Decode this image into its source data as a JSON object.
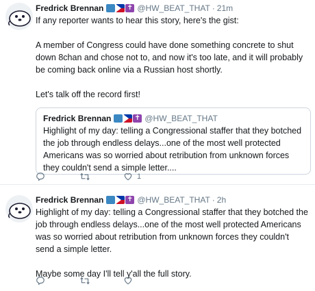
{
  "tweets": [
    {
      "author_name": "Fredrick Brennan",
      "handle": "@HW_BEAT_THAT",
      "separator": "·",
      "time": "21m",
      "paragraphs": [
        "If any reporter wants to hear this story, here's the gist:",
        "A member of Congress could have done something concrete to shut down 8chan and chose not to, and now it's too late, and it will probably be coming back online via a Russian host shortly.",
        "Let's talk off the record first!"
      ],
      "quote": {
        "author_name": "Fredrick Brennan",
        "handle": "@HW_BEAT_THAT",
        "text": "Highlight of my day: telling a Congressional staffer that they botched the job through endless delays...one of the most well protected Americans was so worried about retribution from unknown forces they couldn't send a simple letter...."
      },
      "actions": {
        "reply_count": "",
        "retweet_count": "",
        "like_count": "1"
      }
    },
    {
      "author_name": "Fredrick Brennan",
      "handle": "@HW_BEAT_THAT",
      "separator": "·",
      "time": "2h",
      "paragraphs": [
        "Highlight of my day: telling a Congressional staffer that they botched the job through endless delays...one of the most well protected Americans was so worried about retribution from unknown forces they couldn't send a simple letter.",
        "Maybe some day I'll tell y'all the full story."
      ],
      "actions": {
        "reply_count": "",
        "retweet_count": "",
        "like_count": ""
      }
    }
  ],
  "icons": {
    "reply": "reply-icon",
    "retweet": "retweet-icon",
    "like": "heart-icon",
    "avatar": "cartoon-seal-avatar",
    "name_emojis": [
      "wheelchair-emoji",
      "philippines-flag-emoji",
      "latin-cross-emoji"
    ]
  },
  "colors": {
    "text": "#14171a",
    "secondary": "#657786",
    "border": "#e6ecf0",
    "quote_border": "#ccd6dd"
  }
}
